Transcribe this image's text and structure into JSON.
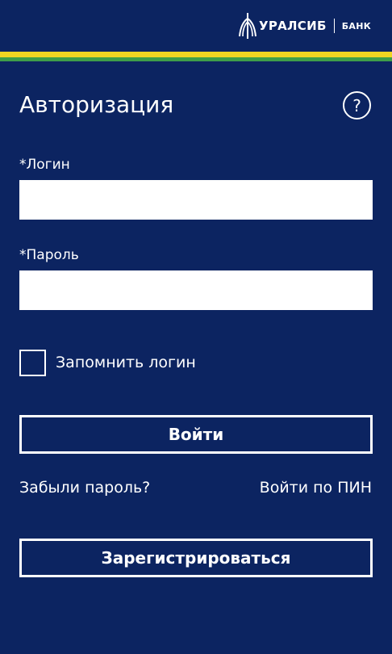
{
  "header": {
    "logo_name": "УРАЛСИБ",
    "logo_suffix": "БАНК"
  },
  "brand_colors": {
    "background": "#0c2461",
    "stripe_yellow": "#f0d522",
    "stripe_green": "#3f9e49"
  },
  "auth": {
    "title": "Авторизация",
    "help_icon": "question-mark-circle-icon",
    "help_glyph": "?",
    "login_label": "*Логин",
    "login_value": "",
    "password_label": "*Пароль",
    "password_value": "",
    "remember_label": "Запомнить логин",
    "remember_checked": false,
    "login_button": "Войти",
    "forgot_link": "Забыли пароль?",
    "pin_link": "Войти по ПИН",
    "register_button": "Зарегистрироваться"
  }
}
